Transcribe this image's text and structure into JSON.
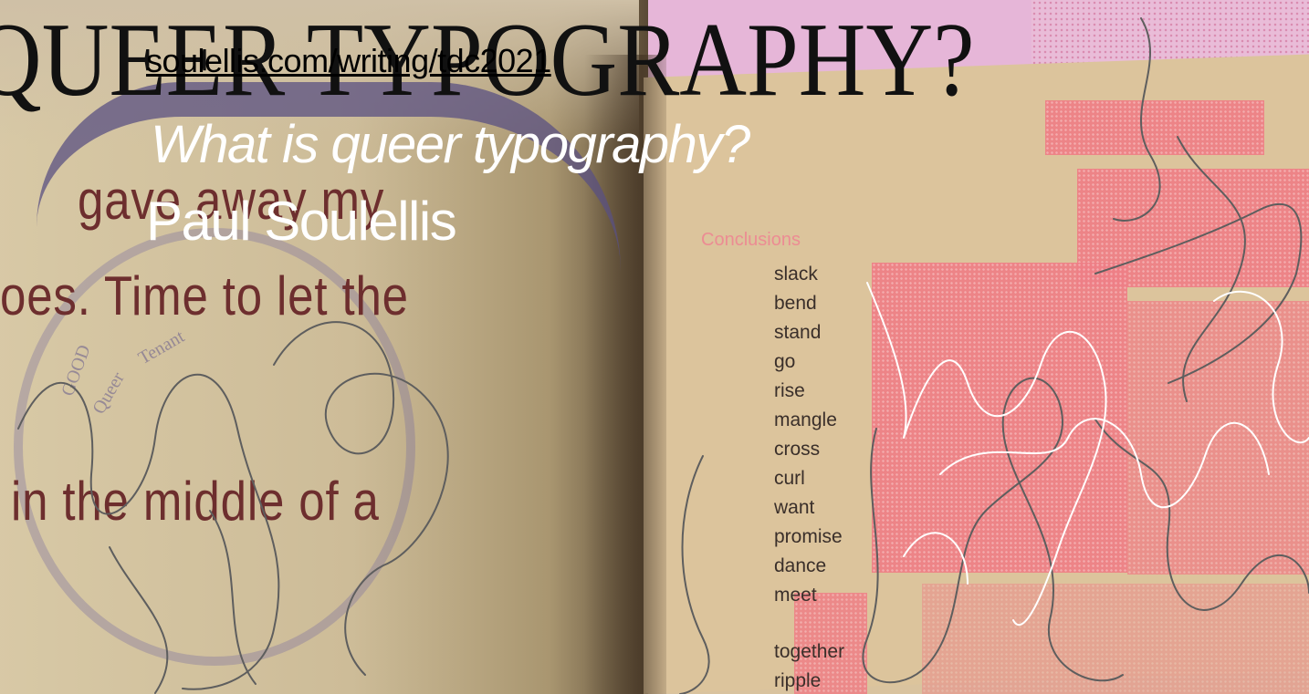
{
  "slide": {
    "title": "QUEER TYPOGRAPHY?",
    "url": "soulellis.com/writing/tdc2021",
    "subtitle": "What is queer typography?",
    "author": "Paul Soulellis"
  },
  "book_left": {
    "lines": [
      "gave away my",
      "oes. Time to let the",
      "in the middle of a"
    ],
    "stamp_words": [
      "GOOD",
      "Queer",
      "Tenant"
    ]
  },
  "book_right": {
    "heading": "Conclusions",
    "words": [
      "slack",
      "bend",
      "stand",
      "go",
      "rise",
      "mangle",
      "cross",
      "curl",
      "want",
      "promise",
      "dance",
      "meet",
      "together",
      "ripple"
    ]
  },
  "colors": {
    "title": "#111111",
    "overlay_text": "#ffffff",
    "book_text": "#6d2e2e",
    "pink_block": "#ef7f86",
    "paper": "#dcc49c"
  }
}
